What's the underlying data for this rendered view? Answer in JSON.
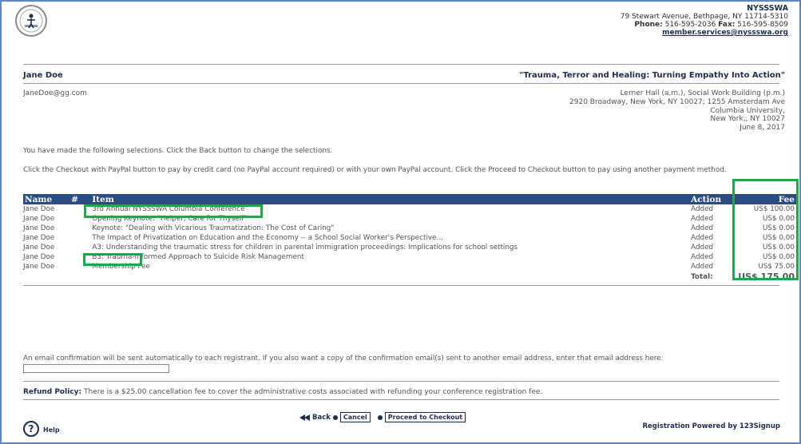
{
  "org": {
    "name": "NYSSSWA",
    "address": "79 Stewart Avenue, Bethpage, NY 11714-5310",
    "phone_label": "Phone:",
    "phone": "516-595-2036",
    "fax_label": "Fax:",
    "fax": "516-595-8509",
    "email": "member.services@nyssswa.org"
  },
  "registrant": {
    "name": "Jane Doe",
    "email": "JaneDoe@gg.com"
  },
  "event": {
    "title": "\"Trauma, Terror and Healing: Turning Empathy Into Action\"",
    "venue_lines": [
      "Lerner Hall (a.m.), Social Work Building (p.m.)",
      "2920 Broadway, New York, NY 10027; 1255 Amsterdam Ave",
      "Columbia University,",
      "New York,, NY 10027",
      "June 8, 2017"
    ]
  },
  "instructions": {
    "line1": "You have made the following selections. Click the Back button to change the selections.",
    "line2": "Click the Checkout with PayPal button to pay by credit card (no PayPal account required) or with your own PayPal account. Click the Proceed to Checkout button to pay using another payment method."
  },
  "table": {
    "headers": {
      "name": "Name",
      "num": "#",
      "item": "Item",
      "action": "Action",
      "fee": "Fee"
    },
    "rows": [
      {
        "name": "Jane Doe",
        "num": "",
        "item": "3rd Annual NYSSSWA Columbia Conference",
        "action": "Added",
        "fee": "US$ 100.00"
      },
      {
        "name": "Jane Doe",
        "num": "",
        "item": "Opening Keynote: \"Helper, Care for Thyself\"",
        "action": "Added",
        "fee": "US$ 0.00"
      },
      {
        "name": "Jane Doe",
        "num": "",
        "item": "Keynote: \"Dealing with Vicarious Traumatization: The Cost of Caring\"",
        "action": "Added",
        "fee": "US$ 0.00"
      },
      {
        "name": "Jane Doe",
        "num": "",
        "item": "The Impact of Privatization on Education and the Economy -- a School Social Worker's Perspective...",
        "action": "Added",
        "fee": "US$ 0.00"
      },
      {
        "name": "Jane Doe",
        "num": "",
        "item": "A3: Understanding the traumatic stress for children in parental immigration proceedings: Implications for school settings",
        "action": "Added",
        "fee": "US$ 0.00"
      },
      {
        "name": "Jane Doe",
        "num": "",
        "item": "B3: Trauma-Informed Approach to Suicide Risk Management",
        "action": "Added",
        "fee": "US$ 0.00"
      },
      {
        "name": "Jane Doe",
        "num": "",
        "item": "Membership Fee",
        "action": "Added",
        "fee": "US$ 75.00"
      }
    ],
    "total_label": "Total:",
    "total_value": "US$ 175.00"
  },
  "confirmation": {
    "text": "An email confirmation will be sent automatically to each registrant. If you also want a copy of the confirmation email(s) sent to another email address, enter that email address here:",
    "value": ""
  },
  "refund": {
    "label": "Refund Policy:",
    "text": " There is a $25.00 cancellation fee to cover the administrative costs associated with refunding your conference registration fee."
  },
  "buttons": {
    "back": "Back",
    "cancel": "Cancel",
    "checkout": "Proceed to Checkout"
  },
  "footer": {
    "help": "Help",
    "powered": "Registration Powered by 123Signup"
  },
  "colors": {
    "header_bg": "#2b4c80",
    "highlight": "#1ea84a",
    "text_dark": "#1d2c4f",
    "frame": "#5b87c5"
  },
  "icons": [
    "nyssswa-logo-icon",
    "back-arrow-icon",
    "radio-dot-icon",
    "help-icon"
  ]
}
